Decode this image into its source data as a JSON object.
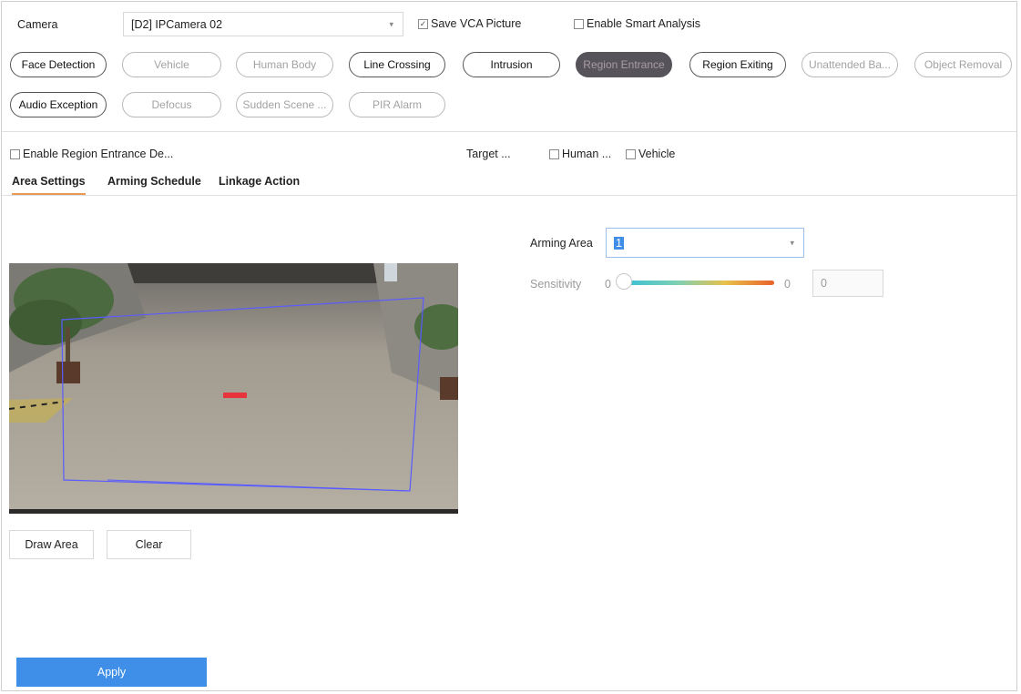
{
  "camera": {
    "label": "Camera",
    "value": "[D2] IPCamera 02"
  },
  "save_vca": {
    "label": "Save VCA Picture",
    "checked": true
  },
  "smart_analysis": {
    "label": "Enable Smart Analysis",
    "checked": false
  },
  "event_types": [
    {
      "label": "Face Detection",
      "state": "enabled"
    },
    {
      "label": "Vehicle",
      "state": "disabled"
    },
    {
      "label": "Human Body",
      "state": "disabled"
    },
    {
      "label": "Line Crossing",
      "state": "enabled"
    },
    {
      "label": "Intrusion",
      "state": "enabled"
    },
    {
      "label": "Region Entrance",
      "state": "selected"
    },
    {
      "label": "Region Exiting",
      "state": "enabled"
    },
    {
      "label": "Unattended Ba...",
      "state": "disabled"
    },
    {
      "label": "Object Removal",
      "state": "disabled"
    },
    {
      "label": "Audio Exception",
      "state": "enabled"
    },
    {
      "label": "Defocus",
      "state": "disabled"
    },
    {
      "label": "Sudden Scene ...",
      "state": "disabled"
    },
    {
      "label": "PIR Alarm",
      "state": "disabled"
    }
  ],
  "enable_region": {
    "label": "Enable Region Entrance De..."
  },
  "target": {
    "label": "Target ...",
    "human": "Human ...",
    "vehicle": "Vehicle"
  },
  "tabs": [
    {
      "label": "Area Settings",
      "active": true
    },
    {
      "label": "Arming Schedule",
      "active": false
    },
    {
      "label": "Linkage Action",
      "active": false
    }
  ],
  "arming_area": {
    "label": "Arming Area",
    "value": "1"
  },
  "sensitivity": {
    "label": "Sensitivity",
    "min": "0",
    "max": "0",
    "value": "0"
  },
  "buttons": {
    "draw_area": "Draw Area",
    "clear": "Clear",
    "apply": "Apply"
  }
}
